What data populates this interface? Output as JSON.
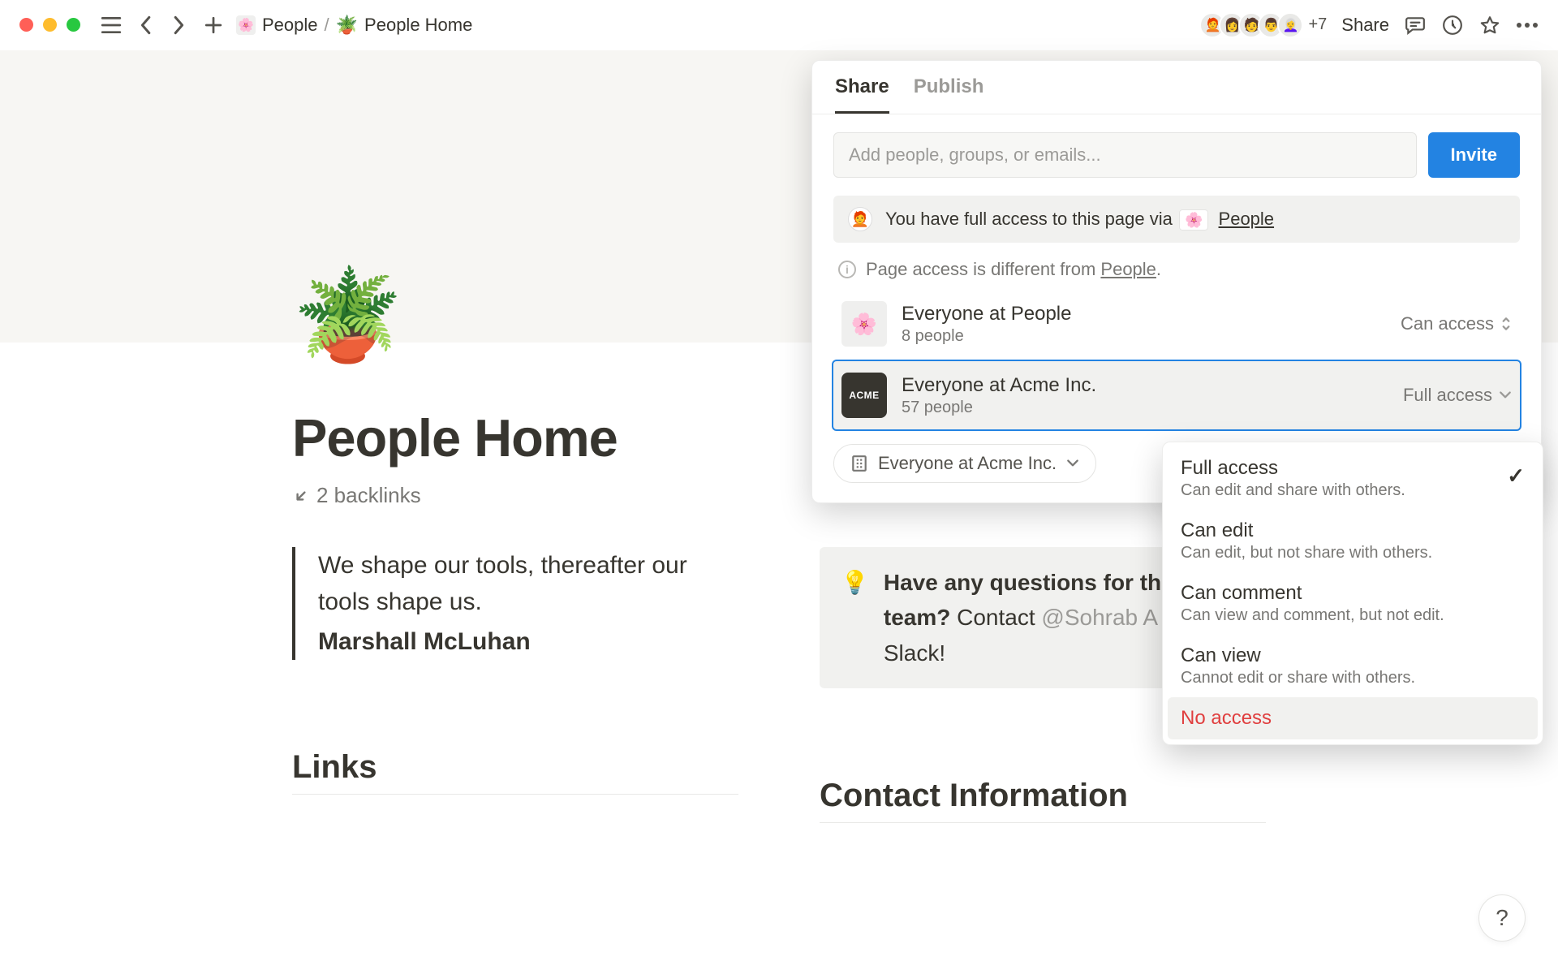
{
  "topbar": {
    "breadcrumb_parent": "People",
    "breadcrumb_parent_icon": "🌸",
    "breadcrumb_sep": "/",
    "breadcrumb_page": "People Home",
    "breadcrumb_page_icon": "🪴",
    "avatars_more": "+7",
    "share_label": "Share"
  },
  "page": {
    "emoji": "🪴",
    "title": "People Home",
    "backlinks": "2 backlinks",
    "quote_line1": "We shape our tools, thereafter our tools shape us.",
    "quote_author": "Marshall McLuhan",
    "callout_icon": "💡",
    "callout_q": "Have any questions for the team? ",
    "callout_contact": "Contact ",
    "callout_mention": "@Sohrab A",
    "callout_tail": " on Slack!",
    "links_heading": "Links",
    "contact_heading": "Contact Information"
  },
  "share": {
    "tab_share": "Share",
    "tab_publish": "Publish",
    "input_placeholder": "Add people, groups, or emails...",
    "invite_btn": "Invite",
    "access_note_prefix": "You have full access to this page via",
    "access_note_chip_icon": "🌸",
    "access_note_link": "People",
    "diff_note_prefix": "Page access is different from ",
    "diff_note_link": "People",
    "diff_note_tail": ".",
    "group1_name": "Everyone at People",
    "group1_count": "8 people",
    "group1_perm": "Can access",
    "group2_name": "Everyone at Acme Inc.",
    "group2_count": "57 people",
    "group2_perm": "Full access",
    "acme_badge": "ACME",
    "everyone_chip": "Everyone at Acme Inc."
  },
  "perm_menu": {
    "items": [
      {
        "title": "Full access",
        "desc": "Can edit and share with others.",
        "checked": true
      },
      {
        "title": "Can edit",
        "desc": "Can edit, but not share with others."
      },
      {
        "title": "Can comment",
        "desc": "Can view and comment, but not edit."
      },
      {
        "title": "Can view",
        "desc": "Cannot edit or share with others."
      },
      {
        "title": "No access",
        "noaccess": true,
        "hovered": true
      }
    ]
  },
  "help_label": "?"
}
